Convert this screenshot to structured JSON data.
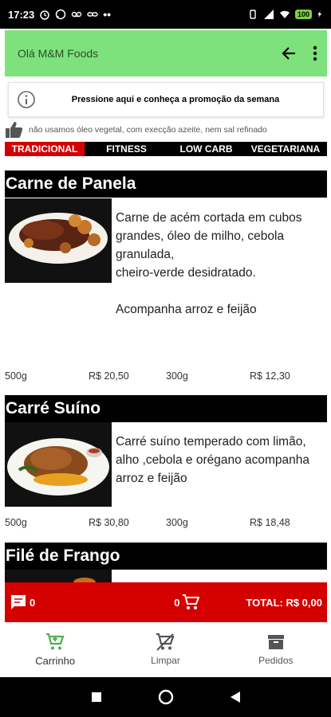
{
  "status_bar": {
    "time": "17:23",
    "battery": "100"
  },
  "app_bar": {
    "title": "Olá M&M Foods"
  },
  "promo": {
    "text": "Pressione aqui e conheça a promoção da semana"
  },
  "notice": {
    "text": "não usamos óleo vegetal, com execção azeite, nem sal refinado"
  },
  "tabs": [
    {
      "label": "TRADICIONAL",
      "active": true
    },
    {
      "label": "FITNESS",
      "active": false
    },
    {
      "label": "LOW CARB",
      "active": false
    },
    {
      "label": "VEGETARIANA",
      "active": false
    }
  ],
  "products": [
    {
      "name": "Carne de Panela",
      "description": "Carne de acém cortada em cubos\ngrandes, óleo de milho, cebola granulada,\ncheiro-verde desidratado.\n\nAcompanha arroz e feijão",
      "prices": [
        {
          "size": "500g",
          "price": "R$ 20,50"
        },
        {
          "size": "300g",
          "price": "R$ 12,30"
        }
      ]
    },
    {
      "name": "Carré Suíno",
      "description": "Carré suíno temperado com limão, alho ,cebola e orégano acompanha arroz e feijão",
      "prices": [
        {
          "size": "500g",
          "price": "R$ 30,80"
        },
        {
          "size": "300g",
          "price": "R$ 18,48"
        }
      ]
    },
    {
      "name": "Filé de Frango"
    }
  ],
  "cart_bar": {
    "message_count": "0",
    "cart_count": "0",
    "total": "TOTAL: R$ 0,00"
  },
  "bottom_nav": [
    {
      "label": "Carrinho",
      "icon": "cart-icon",
      "selected": true
    },
    {
      "label": "Limpar",
      "icon": "clear-cart-icon",
      "selected": false
    },
    {
      "label": "Pedidos",
      "icon": "orders-icon",
      "selected": false
    }
  ],
  "colors": {
    "app_bar": "#7ee27c",
    "accent_red": "#d40000",
    "nav_green": "#4caf50",
    "header_black": "#000000"
  }
}
